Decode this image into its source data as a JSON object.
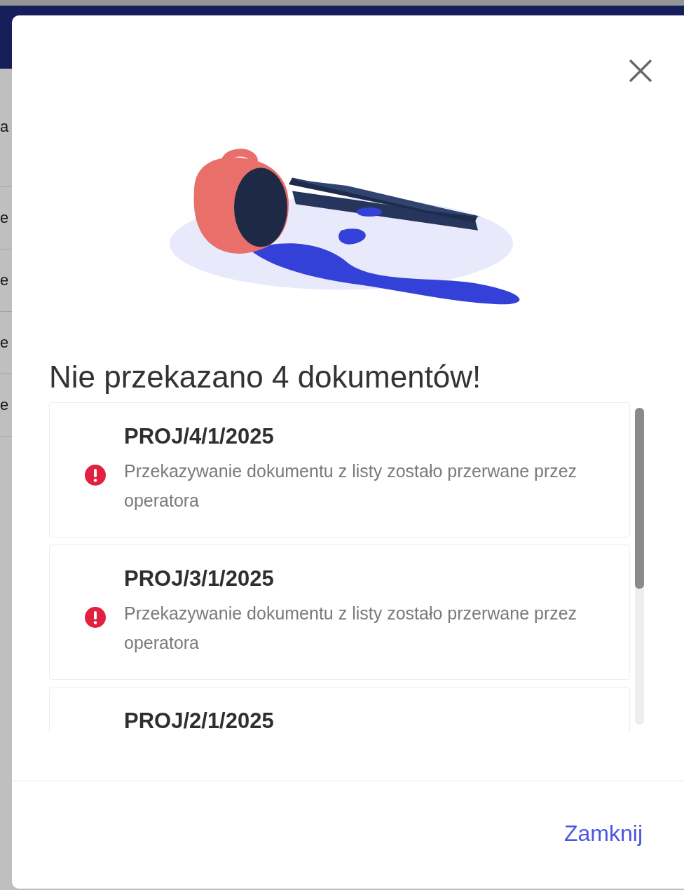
{
  "background": {
    "row_texts": [
      "a",
      "e",
      "e",
      "e",
      "e"
    ]
  },
  "dialog": {
    "title": "Nie przekazano 4 dokumentów!",
    "errors": [
      {
        "document": "PROJ/4/1/2025",
        "message": "Przekazywanie dokumentu z listy zostało przerwane przez operatora"
      },
      {
        "document": "PROJ/3/1/2025",
        "message": "Przekazywanie dokumentu z listy zostało przerwane przez operatora"
      },
      {
        "document": "PROJ/2/1/2025"
      }
    ],
    "close_button": "Zamknij"
  }
}
